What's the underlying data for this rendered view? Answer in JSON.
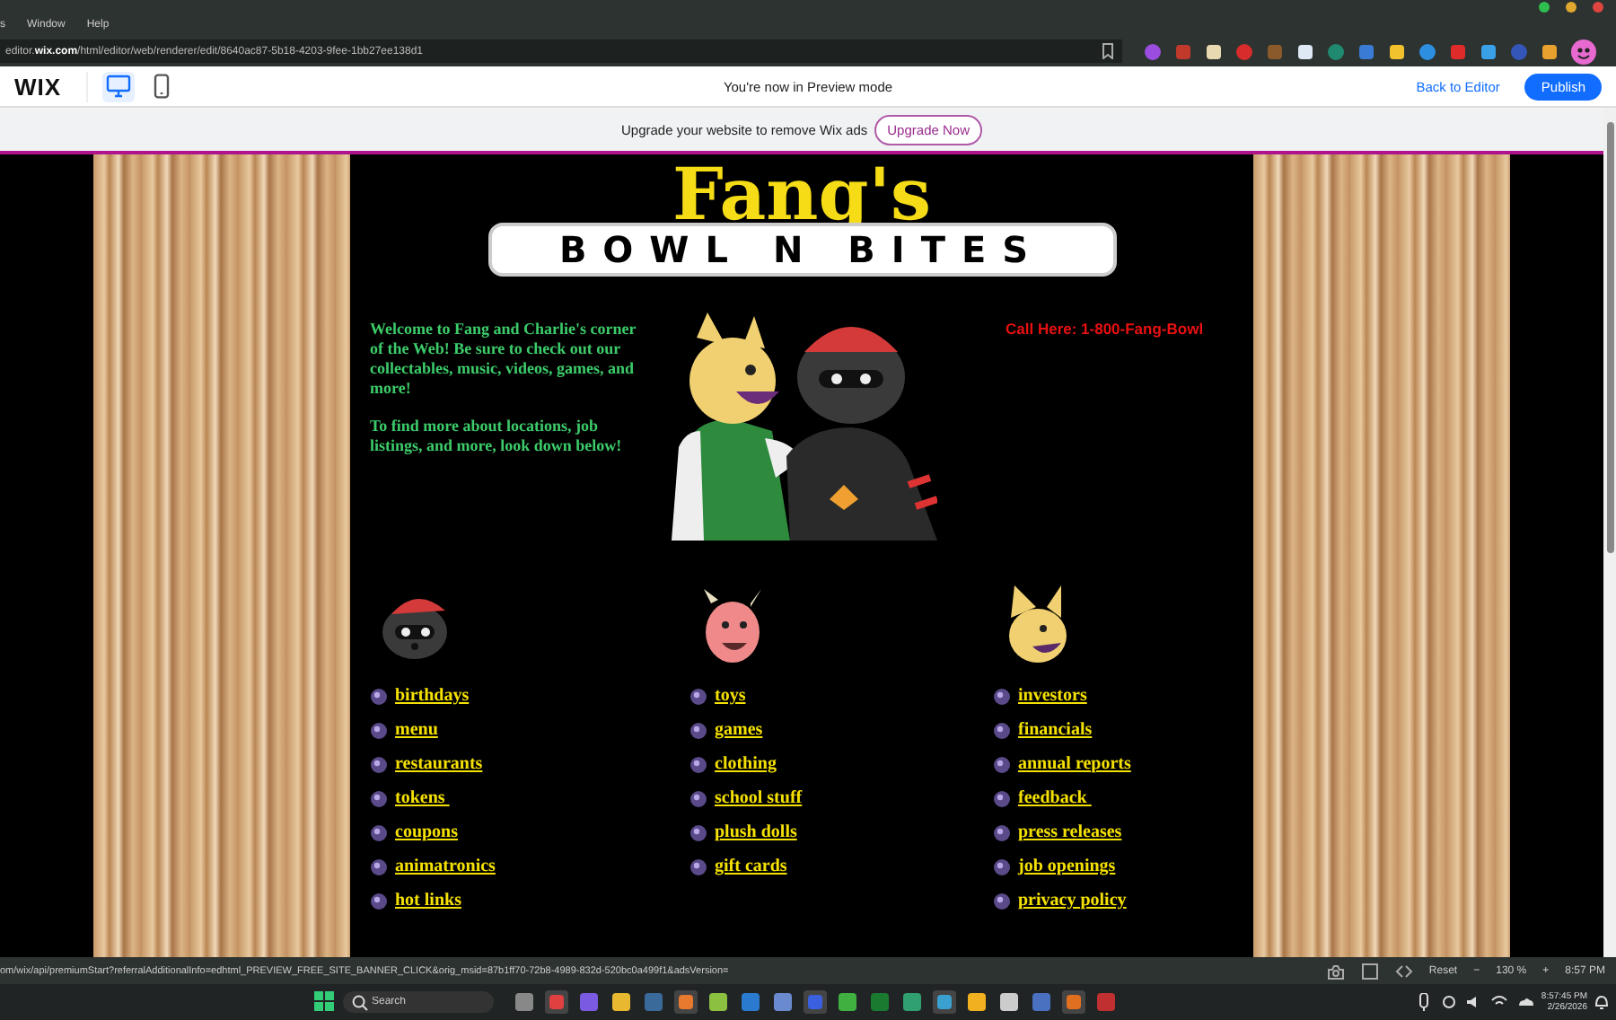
{
  "browser": {
    "menu": [
      "s",
      "Window",
      "Help"
    ],
    "url_host": "editor.",
    "url_domain": "wix.com",
    "url_path": "/html/editor/web/renderer/edit/8640ac87-5b18-4203-9fee-1bb27ee138d1"
  },
  "preview_bar": {
    "logo": "WIX",
    "devices": [
      {
        "kind": "desktop",
        "selected": true
      },
      {
        "kind": "mobile",
        "selected": false
      }
    ],
    "message": "You're now in Preview mode",
    "back_link": "Back to Editor",
    "publish_button": "Publish"
  },
  "ad_banner": {
    "text": "Upgrade your website to remove Wix ads",
    "button": "Upgrade Now"
  },
  "site": {
    "logo_title": "Fang's",
    "logo_subtitle": "BOWL N BITES",
    "welcome": [
      "Welcome to Fang and Charlie's corner of the Web! Be sure to check out our collectables, music, videos, games, and more!",
      "To find more about locations, job listings, and more, look down below!"
    ],
    "phone": "Call Here: 1-800-Fang-Bowl",
    "columns": [
      {
        "kind": "raccoon",
        "links": [
          "birthdays",
          "menu",
          "restaurants",
          "tokens ",
          "coupons",
          "animatronics",
          "hot links"
        ]
      },
      {
        "kind": "goat",
        "links": [
          "toys",
          "games",
          "clothing",
          "school stuff",
          "plush dolls",
          "gift cards"
        ]
      },
      {
        "kind": "fox",
        "links": [
          "investors",
          "financials",
          "annual reports",
          "feedback ",
          "press releases",
          "job openings",
          "privacy policy"
        ]
      }
    ]
  },
  "status_bar": {
    "url": "om/wix/api/premiumStart?referralAdditionalInfo=edhtml_PREVIEW_FREE_SITE_BANNER_CLICK&orig_msid=87b1ff70-72b8-4989-832d-520bc0a499f1&adsVersion=",
    "reset": "Reset",
    "zoom_out": "−",
    "zoom": "130 %",
    "zoom_in": "+",
    "clock": "8:57 PM"
  },
  "taskbar": {
    "search_placeholder": "Search",
    "time": "8:57:45 PM",
    "date": "2/26/2026"
  }
}
